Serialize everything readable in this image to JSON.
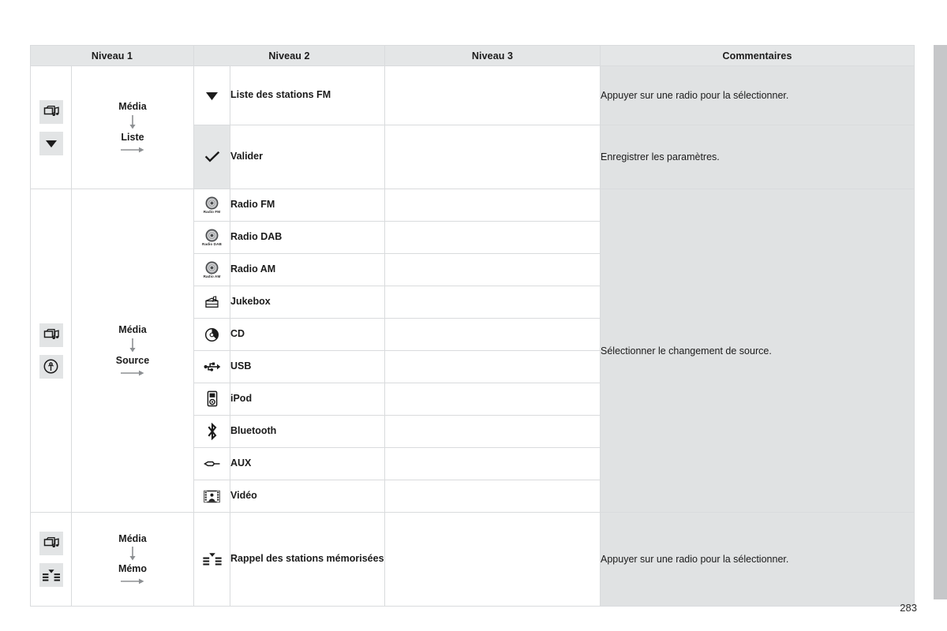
{
  "page": {
    "number": "283",
    "background": "#ffffff",
    "edge_tab_color": "#c6c7c9"
  },
  "table": {
    "headers": [
      {
        "id": "niveau1",
        "label": "Niveau 1"
      },
      {
        "id": "niveau2",
        "label": "Niveau 2"
      },
      {
        "id": "niveau3",
        "label": "Niveau 3"
      },
      {
        "id": "commentaires",
        "label": "Commentaires"
      }
    ],
    "header_bg": "#e4e6e7",
    "comment_bg": "#e0e2e3",
    "groups": [
      {
        "id": "media-liste",
        "path": {
          "icons": [
            "media-icon",
            "down-triangle-icon"
          ],
          "steps": [
            "Média",
            "Liste"
          ]
        },
        "rows": [
          {
            "icon": "down-triangle-icon",
            "icon_shaded": false,
            "label": "Liste des stations FM",
            "niveau3": "",
            "comment": "Appuyer sur une radio pour la sélectionner."
          },
          {
            "icon": "check-icon",
            "icon_shaded": true,
            "label": "Valider",
            "niveau3": "",
            "comment": "Enregistrer les paramètres."
          }
        ]
      },
      {
        "id": "media-source",
        "path": {
          "icons": [
            "media-icon",
            "source-antenna-icon"
          ],
          "steps": [
            "Média",
            "Source"
          ]
        },
        "comment": "Sélectionner le changement de source.",
        "rows": [
          {
            "icon": "radio-fm-icon",
            "icon_label": "Radio FM",
            "label": "Radio FM",
            "niveau3": ""
          },
          {
            "icon": "radio-dab-icon",
            "icon_label": "Radio DAB",
            "label": "Radio DAB",
            "niveau3": ""
          },
          {
            "icon": "radio-am-icon",
            "icon_label": "Radio AM",
            "label": "Radio AM",
            "niveau3": ""
          },
          {
            "icon": "jukebox-icon",
            "icon_label": "",
            "label": "Jukebox",
            "niveau3": ""
          },
          {
            "icon": "cd-icon",
            "icon_label": "",
            "label": "CD",
            "niveau3": ""
          },
          {
            "icon": "usb-icon",
            "icon_label": "",
            "label": "USB",
            "niveau3": ""
          },
          {
            "icon": "ipod-icon",
            "icon_label": "",
            "label": "iPod",
            "niveau3": ""
          },
          {
            "icon": "bluetooth-icon",
            "icon_label": "",
            "label": "Bluetooth",
            "niveau3": ""
          },
          {
            "icon": "aux-icon",
            "icon_label": "",
            "label": "AUX",
            "niveau3": ""
          },
          {
            "icon": "video-icon",
            "icon_label": "",
            "label": "Vidéo",
            "niveau3": ""
          }
        ]
      },
      {
        "id": "media-memo",
        "path": {
          "icons": [
            "media-icon",
            "presets-icon"
          ],
          "steps": [
            "Média",
            "Mémo"
          ]
        },
        "rows": [
          {
            "icon": "presets-icon",
            "icon_shaded": false,
            "label": "Rappel des stations mémorisées",
            "niveau3": "",
            "comment": "Appuyer sur une radio pour la sélectionner."
          }
        ]
      }
    ]
  }
}
